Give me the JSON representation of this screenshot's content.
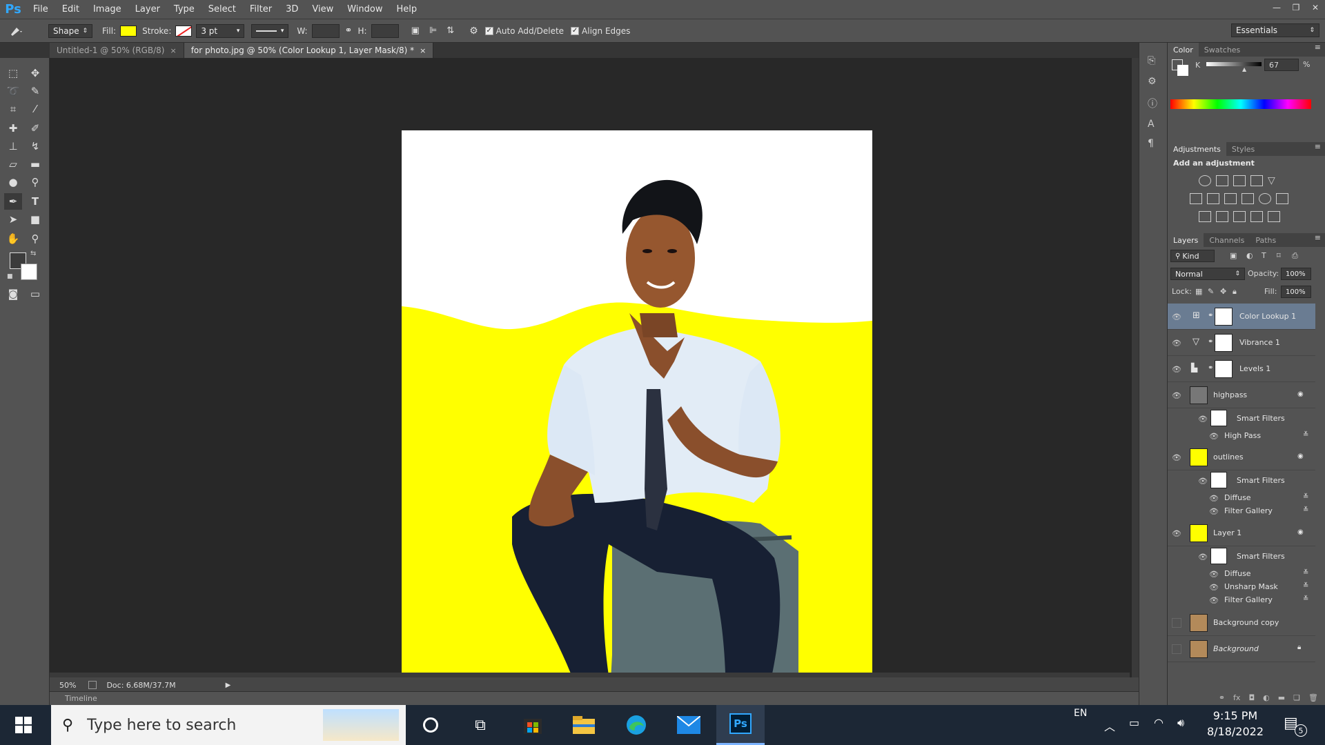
{
  "menubar": {
    "logo": "Ps",
    "items": [
      "File",
      "Edit",
      "Image",
      "Layer",
      "Type",
      "Select",
      "Filter",
      "3D",
      "View",
      "Window",
      "Help"
    ]
  },
  "options": {
    "mode": "Shape",
    "fill_label": "Fill:",
    "fill_color": "#ffff00",
    "stroke_label": "Stroke:",
    "stroke_width": "3 pt",
    "w_label": "W:",
    "h_label": "H:",
    "auto_add_delete": "Auto Add/Delete",
    "align_edges": "Align Edges",
    "workspace": "Essentials"
  },
  "tabs": [
    {
      "label": "Untitled-1 @ 50% (RGB/8)",
      "close": "×"
    },
    {
      "label": "for photo.jpg @ 50% (Color Lookup 1, Layer Mask/8) *",
      "close": "×"
    }
  ],
  "status": {
    "zoom": "50%",
    "doc": "Doc: 6.68M/37.7M",
    "timeline": "Timeline"
  },
  "color_panel": {
    "tabs": [
      "Color",
      "Swatches"
    ],
    "channel": "K",
    "value": "67",
    "unit": "%"
  },
  "adjustments_panel": {
    "tabs": [
      "Adjustments",
      "Styles"
    ],
    "heading": "Add an adjustment"
  },
  "layers_panel": {
    "tabs": [
      "Layers",
      "Channels",
      "Paths"
    ],
    "kind": "Kind",
    "blend_mode": "Normal",
    "opacity_label": "Opacity:",
    "opacity": "100%",
    "lock_label": "Lock:",
    "fill_label": "Fill:",
    "fill": "100%",
    "layers": [
      {
        "name": "Color Lookup 1",
        "selected": true
      },
      {
        "name": "Vibrance 1"
      },
      {
        "name": "Levels 1"
      },
      {
        "name": "highpass",
        "smart_filters": "Smart Filters",
        "filters": [
          "High Pass"
        ]
      },
      {
        "name": "outlines",
        "smart_filters": "Smart Filters",
        "filters": [
          "Diffuse",
          "Filter Gallery"
        ]
      },
      {
        "name": "Layer 1",
        "smart_filters": "Smart Filters",
        "filters": [
          "Diffuse",
          "Unsharp Mask",
          "Filter Gallery"
        ]
      },
      {
        "name": "Background copy"
      },
      {
        "name": "Background"
      }
    ]
  },
  "taskbar": {
    "search_placeholder": "Type here to search",
    "language": "EN",
    "time": "9:15 PM",
    "date": "8/18/2022",
    "notifications": "5"
  },
  "colors": {
    "canvas_yellow": "#ffff00",
    "accent_ps": "#31a8ff"
  }
}
